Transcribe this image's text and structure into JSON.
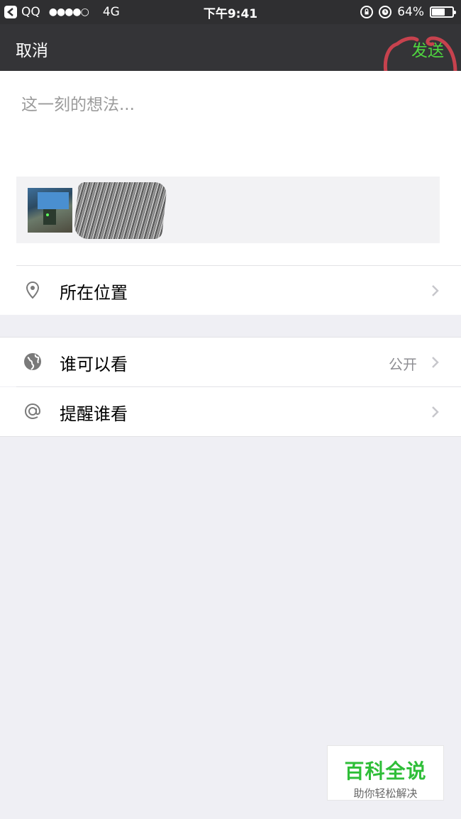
{
  "status_bar": {
    "back_app": "QQ",
    "signal": "●●●●○",
    "network": "4G",
    "time": "下午9:41",
    "battery": "64%",
    "battery_fraction": 0.64,
    "icons": [
      "rotation-lock-icon",
      "alarm-icon",
      "battery-icon"
    ]
  },
  "nav": {
    "cancel_label": "取消",
    "send_label": "发送"
  },
  "compose": {
    "placeholder": "这一刻的想法..."
  },
  "rows": {
    "location": {
      "label": "所在位置",
      "icon": "location-pin-icon"
    },
    "visibility": {
      "label": "谁可以看",
      "value": "公开",
      "icon": "globe-icon"
    },
    "mention": {
      "label": "提醒谁看",
      "icon": "at-sign-icon"
    }
  },
  "watermark": {
    "title": "百科全说",
    "subtitle": "助你轻松解决"
  },
  "colors": {
    "nav_background": "#343437",
    "send_accent": "#4fd53f",
    "page_background": "#efeff4",
    "annotation_circle": "#c7424e"
  }
}
